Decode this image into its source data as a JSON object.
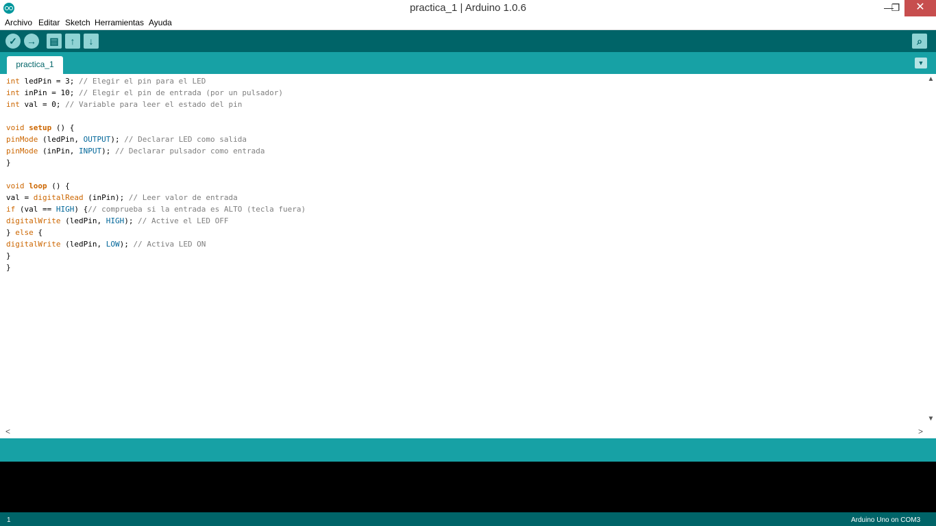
{
  "window": {
    "title": "practica_1 | Arduino 1.0.6",
    "minimize": "—",
    "maximize": "❐",
    "close": "✕"
  },
  "menu": [
    "Archivo",
    "Editar",
    "Sketch",
    "Herramientas",
    "Ayuda"
  ],
  "toolbar": {
    "verify_icon": "✓",
    "upload_icon": "→",
    "new_icon": "▤",
    "open_icon": "↑",
    "save_icon": "↓",
    "serial_icon": "⌕"
  },
  "tabs": [
    {
      "label": "practica_1"
    }
  ],
  "tab_menu_icon": "▼",
  "code": [
    [
      [
        "kw",
        "int"
      ],
      [
        "t",
        " ledPin = 3; "
      ],
      [
        "cm",
        "// Elegir el pin para el LED"
      ]
    ],
    [
      [
        "kw",
        "int"
      ],
      [
        "t",
        " inPin = 10; "
      ],
      [
        "cm",
        "// Elegir el pin de entrada (por un pulsador)"
      ]
    ],
    [
      [
        "kw",
        "int"
      ],
      [
        "t",
        " val = 0; "
      ],
      [
        "cm",
        "// Variable para leer el estado del pin"
      ]
    ],
    [],
    [
      [
        "kw",
        "void"
      ],
      [
        "t",
        " "
      ],
      [
        "kwb",
        "setup"
      ],
      [
        "t",
        " () {"
      ]
    ],
    [
      [
        "kw",
        "pinMode"
      ],
      [
        "t",
        " (ledPin, "
      ],
      [
        "cst",
        "OUTPUT"
      ],
      [
        "t",
        "); "
      ],
      [
        "cm",
        "// Declarar LED como salida"
      ]
    ],
    [
      [
        "kw",
        "pinMode"
      ],
      [
        "t",
        " (inPin, "
      ],
      [
        "cst",
        "INPUT"
      ],
      [
        "t",
        "); "
      ],
      [
        "cm",
        "// Declarar pulsador como entrada"
      ]
    ],
    [
      [
        "t",
        "}"
      ]
    ],
    [],
    [
      [
        "kw",
        "void"
      ],
      [
        "t",
        " "
      ],
      [
        "kwb",
        "loop"
      ],
      [
        "t",
        " () {"
      ]
    ],
    [
      [
        "t",
        "val = "
      ],
      [
        "kw",
        "digitalRead"
      ],
      [
        "t",
        " (inPin); "
      ],
      [
        "cm",
        "// Leer valor de entrada"
      ]
    ],
    [
      [
        "kw",
        "if"
      ],
      [
        "t",
        " (val == "
      ],
      [
        "cst",
        "HIGH"
      ],
      [
        "t",
        ") {"
      ],
      [
        "cm",
        "// comprueba si la entrada es ALTO (tecla fuera)"
      ]
    ],
    [
      [
        "kw",
        "digitalWrite"
      ],
      [
        "t",
        " (ledPin, "
      ],
      [
        "cst",
        "HIGH"
      ],
      [
        "t",
        "); "
      ],
      [
        "cm",
        "// Active el LED OFF"
      ]
    ],
    [
      [
        "t",
        "} "
      ],
      [
        "kw",
        "else"
      ],
      [
        "t",
        " {"
      ]
    ],
    [
      [
        "kw",
        "digitalWrite"
      ],
      [
        "t",
        " (ledPin, "
      ],
      [
        "cst",
        "LOW"
      ],
      [
        "t",
        "); "
      ],
      [
        "cm",
        "// Activa LED ON"
      ]
    ],
    [
      [
        "t",
        "}"
      ]
    ],
    [
      [
        "t",
        "}"
      ]
    ]
  ],
  "scroll": {
    "up": "▲",
    "down": "▼",
    "left": "<",
    "right": ">"
  },
  "footer": {
    "line_number": "1",
    "board": "Arduino Uno on COM3"
  }
}
